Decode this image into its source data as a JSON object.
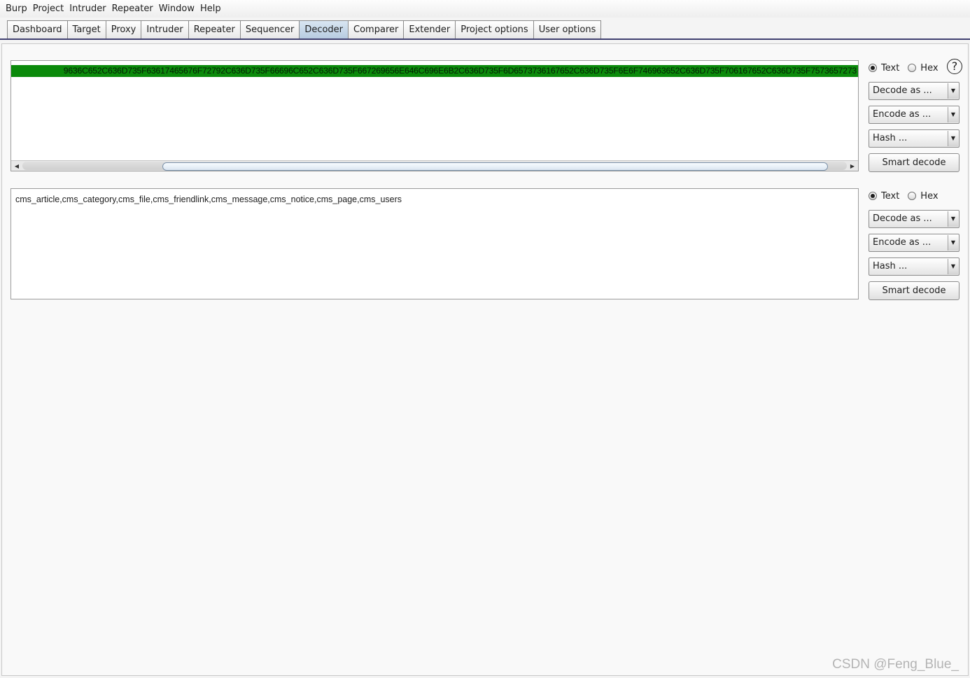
{
  "menu": [
    "Burp",
    "Project",
    "Intruder",
    "Repeater",
    "Window",
    "Help"
  ],
  "tabs": [
    {
      "label": "Dashboard",
      "active": false
    },
    {
      "label": "Target",
      "active": false
    },
    {
      "label": "Proxy",
      "active": false
    },
    {
      "label": "Intruder",
      "active": false
    },
    {
      "label": "Repeater",
      "active": false
    },
    {
      "label": "Sequencer",
      "active": false
    },
    {
      "label": "Decoder",
      "active": true
    },
    {
      "label": "Comparer",
      "active": false
    },
    {
      "label": "Extender",
      "active": false
    },
    {
      "label": "Project options",
      "active": false
    },
    {
      "label": "User options",
      "active": false
    }
  ],
  "panel1": {
    "content": "9636C652C636D735F63617465676F72792C636D735F66696C652C636D735F667269656E646C696E6B2C636D735F6D6573736167652C636D735F6E6F746963652C636D735F706167652C636D735F7573657273",
    "format_text": "Text",
    "format_hex": "Hex",
    "selected_format": "Text",
    "decode_label": "Decode as ...",
    "encode_label": "Encode as ...",
    "hash_label": "Hash ...",
    "smart_decode": "Smart decode",
    "help": "?"
  },
  "panel2": {
    "content": "cms_article,cms_category,cms_file,cms_friendlink,cms_message,cms_notice,cms_page,cms_users",
    "format_text": "Text",
    "format_hex": "Hex",
    "selected_format": "Text",
    "decode_label": "Decode as ...",
    "encode_label": "Encode as ...",
    "hash_label": "Hash ...",
    "smart_decode": "Smart decode"
  },
  "watermark": "CSDN @Feng_Blue_",
  "colors": {
    "highlight": "#0b8a0b",
    "tab_active": "#c3d4e6",
    "tab_underline": "#3f3f6f"
  }
}
